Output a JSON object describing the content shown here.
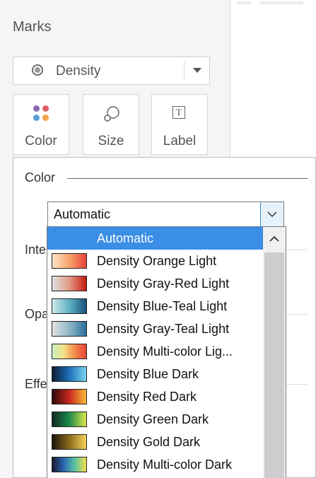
{
  "marks_card": {
    "title": "Marks",
    "mark_type": {
      "label": "Density",
      "icon": "density-icon"
    },
    "buttons": [
      {
        "label": "Color",
        "icon": "color-dots-icon"
      },
      {
        "label": "Size",
        "icon": "size-icon"
      },
      {
        "label": "Label",
        "icon": "label-icon"
      }
    ]
  },
  "color_popup": {
    "section_title": "Color",
    "partial_labels": [
      "Inte",
      "Opa",
      "Effe"
    ],
    "combo": {
      "value": "Automatic"
    },
    "options": [
      {
        "label": "Automatic",
        "selected": true,
        "gradient": []
      },
      {
        "label": "Density Orange Light",
        "gradient": [
          "#fde3c9",
          "#f9a56b",
          "#e8423a"
        ]
      },
      {
        "label": "Density Gray-Red Light",
        "gradient": [
          "#e0e0e0",
          "#e09b86",
          "#c81a10"
        ]
      },
      {
        "label": "Density Blue-Teal Light",
        "gradient": [
          "#cfe8ec",
          "#5fb3c4",
          "#1a4f7a"
        ]
      },
      {
        "label": "Density Gray-Teal Light",
        "gradient": [
          "#e3e3e3",
          "#8fb7c8",
          "#2a6f99"
        ]
      },
      {
        "label": "Density Multi-color Lig...",
        "gradient": [
          "#c9f0c0",
          "#f4e38a",
          "#f28a48",
          "#e8423a"
        ]
      },
      {
        "label": "Density Blue Dark",
        "gradient": [
          "#0c1b34",
          "#1d6fb8",
          "#7ad7f0"
        ]
      },
      {
        "label": "Density Red Dark",
        "gradient": [
          "#2a0a0a",
          "#c9261e",
          "#f9ba35"
        ]
      },
      {
        "label": "Density Green Dark",
        "gradient": [
          "#0b2b1e",
          "#1f8a4c",
          "#d9e94a"
        ]
      },
      {
        "label": "Density Gold Dark",
        "gradient": [
          "#1e1406",
          "#8a6a1d",
          "#f6d35a"
        ]
      },
      {
        "label": "Density Multi-color Dark",
        "gradient": [
          "#1a1a2e",
          "#2b66b3",
          "#5cc3a0",
          "#f5e14a"
        ]
      }
    ]
  },
  "colors": {
    "selection": "#3a8ee6",
    "combo_button_bg": "#e5f1fb",
    "panel_bg": "#f5f5f5"
  }
}
